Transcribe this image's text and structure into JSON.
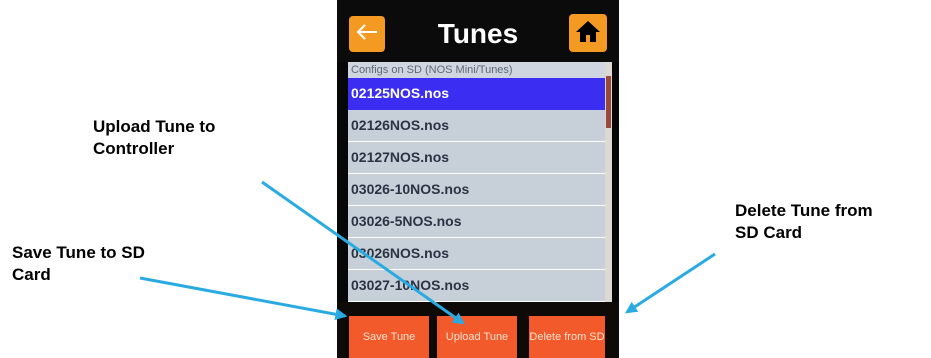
{
  "screen": {
    "title": "Tunes",
    "list_caption": "Configs on SD (NOS Mini/Tunes)",
    "files": [
      "02125NOS.nos",
      "02126NOS.nos",
      "02127NOS.nos",
      "03026-10NOS.nos",
      "03026-5NOS.nos",
      "03026NOS.nos",
      "03027-10NOS.nos"
    ],
    "buttons": {
      "save": "Save Tune",
      "upload": "Upload Tune",
      "delete": "Delete from SD"
    },
    "icons": {
      "back": "left-arrow-icon",
      "home": "home-icon"
    },
    "colors": {
      "accent_orange": "#f49a22",
      "button_red_orange": "#f25a2b",
      "selected_blue": "#3b2df2",
      "annotation_arrow": "#29abe2"
    }
  },
  "annotations": {
    "upload_line1": "Upload Tune to",
    "upload_line2": "Controller",
    "save_line1": "Save Tune to SD",
    "save_line2": "Card",
    "delete_line1": "Delete Tune from",
    "delete_line2": "SD Card"
  }
}
